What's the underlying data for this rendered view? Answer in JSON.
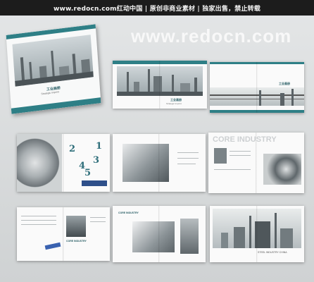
{
  "header": {
    "site_banner": "www.redocn.com红动中国 | 原创非商业素材 | 独家出售，禁止转载"
  },
  "watermark": "www.redocn.com",
  "cover": {
    "title": "工业画册",
    "subtitle": "Strategic Imprint"
  },
  "spreads": {
    "spread1_title": "工业画册",
    "spread1_subtitle": "Strategic Imprint",
    "spread2_title": "工业画册",
    "numbers": [
      "2",
      "1",
      "3",
      "4",
      "5"
    ],
    "core_industry_ghost": "CORE INDUSTRY",
    "core_industry_label": "CORE INDUSTRY",
    "core_industry_label2": "CORE INDUSTRY",
    "steel_caption": "STEEL INDUSTRY CHINA"
  }
}
